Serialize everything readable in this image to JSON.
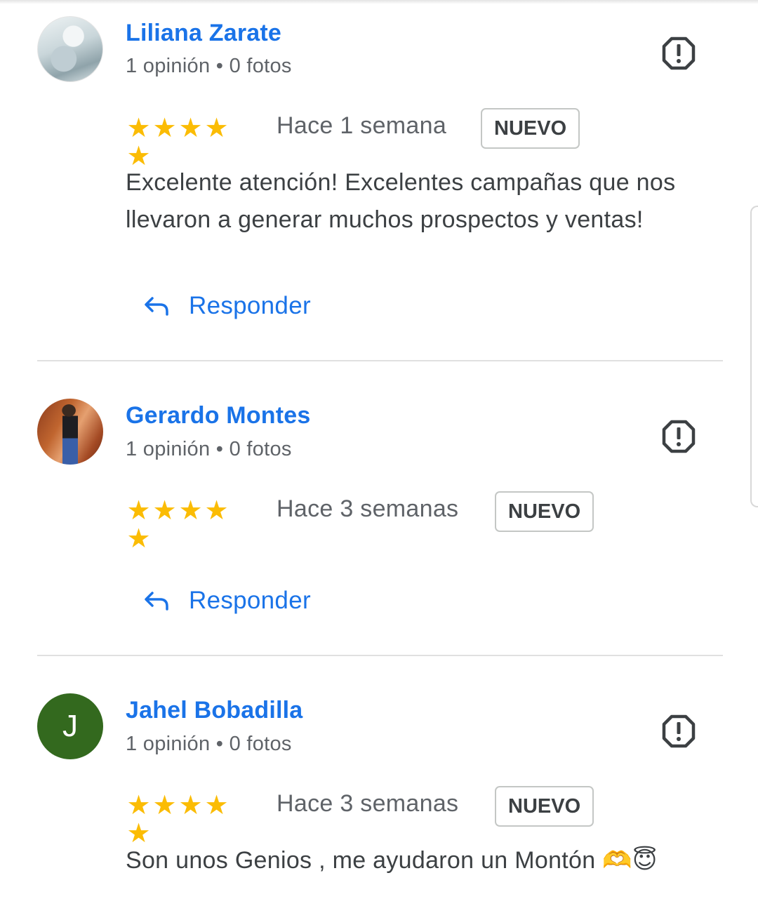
{
  "reviews": [
    {
      "reviewer": "Liliana Zarate",
      "meta": "1 opinión • 0 fotos",
      "rating": 5,
      "stars": "★★★★★",
      "time": "Hace 1 semana",
      "badge": "NUEVO",
      "text": "Excelente atención! Excelentes campañas que nos llevaron a generar muchos prospectos y ventas!",
      "reply_label": "Responder",
      "avatar": "photo"
    },
    {
      "reviewer": "Gerardo Montes",
      "meta": "1 opinión • 0 fotos",
      "rating": 5,
      "stars": "★★★★★",
      "time": "Hace 3 semanas",
      "badge": "NUEVO",
      "text": "",
      "reply_label": "Responder",
      "avatar": "photo"
    },
    {
      "reviewer": "Jahel Bobadilla",
      "meta": "1 opinión • 0 fotos",
      "rating": 5,
      "stars": "★★★★★",
      "time": "Hace 3 semanas",
      "badge": "NUEVO",
      "text": "Son unos Genios , me ayudaron un Montón 🫶😇",
      "avatar_initial": "J",
      "avatar_color": "#33691e"
    }
  ],
  "icons": {
    "report": "report-icon",
    "reply": "reply-arrow-icon",
    "star": "star-icon"
  },
  "colors": {
    "name": "#1a73e8",
    "star": "#fbbc04",
    "secondary_text": "#5f6368",
    "divider": "#e0e0e0"
  }
}
